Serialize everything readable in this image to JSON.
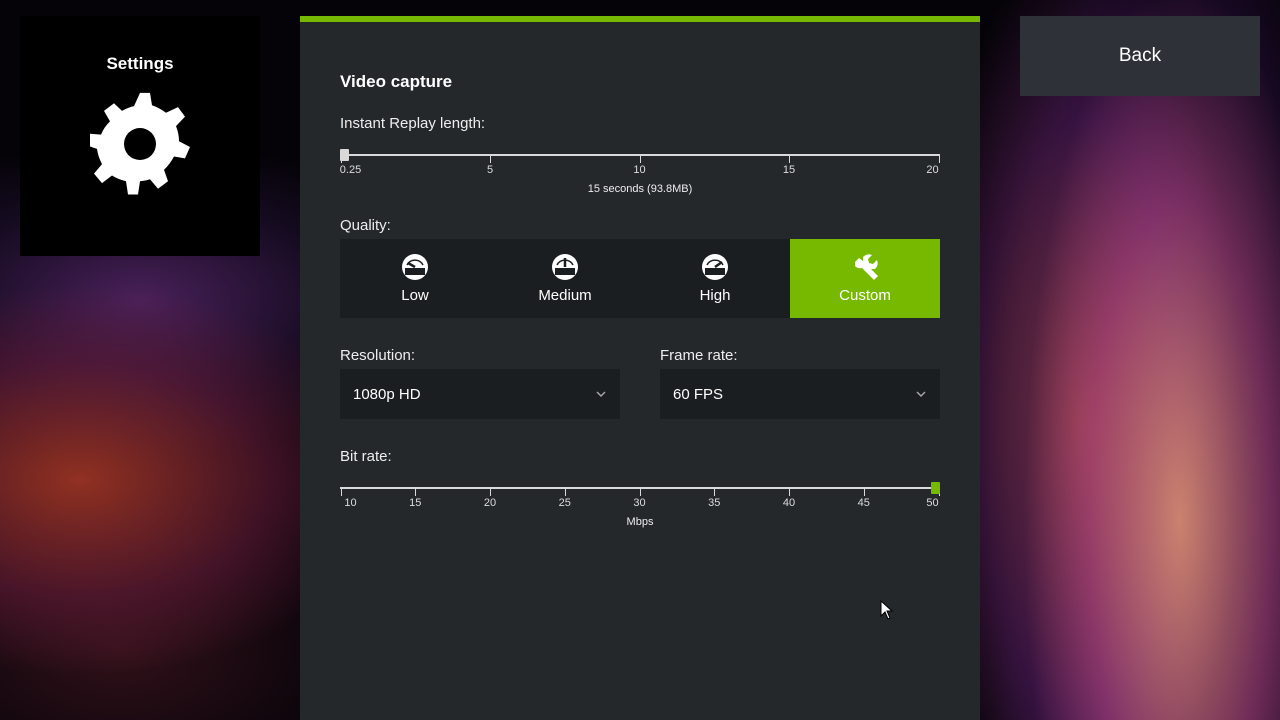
{
  "sidebar": {
    "title": "Settings",
    "icon": "gear-icon"
  },
  "back_button": {
    "label": "Back"
  },
  "panel": {
    "accent_color": "#76b900",
    "section_title": "Video capture",
    "instant_replay": {
      "label": "Instant Replay length:",
      "ticks": [
        "0.25",
        "5",
        "10",
        "15",
        "20"
      ],
      "value": 0.25,
      "caption": "15 seconds (93.8MB)"
    },
    "quality": {
      "label": "Quality:",
      "options": [
        {
          "label": "Low",
          "icon": "gauge-low-icon"
        },
        {
          "label": "Medium",
          "icon": "gauge-medium-icon"
        },
        {
          "label": "High",
          "icon": "gauge-high-icon"
        },
        {
          "label": "Custom",
          "icon": "wrench-icon"
        }
      ],
      "selected": "Custom"
    },
    "resolution": {
      "label": "Resolution:",
      "value": "1080p HD"
    },
    "frame_rate": {
      "label": "Frame rate:",
      "value": "60 FPS"
    },
    "bit_rate": {
      "label": "Bit rate:",
      "ticks": [
        "10",
        "15",
        "20",
        "25",
        "30",
        "35",
        "40",
        "45",
        "50"
      ],
      "value": 50,
      "unit": "Mbps"
    }
  }
}
